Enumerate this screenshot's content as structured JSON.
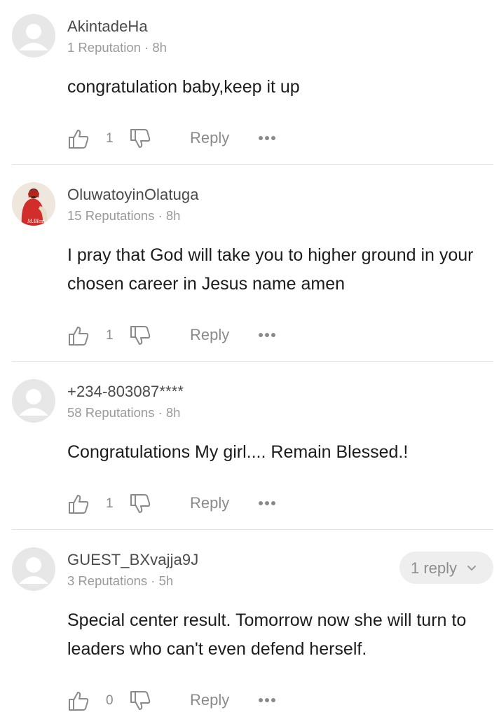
{
  "icons": {
    "like": "thumbs-up-icon",
    "dislike": "thumbs-down-icon",
    "more": "more-horizontal-icon",
    "chevron": "chevron-down-icon"
  },
  "colors": {
    "username": "#4a4a4a",
    "meta": "#9a9a9a",
    "action": "#8a8a8a",
    "divider": "#e4e4e4",
    "pill_bg": "#eeeeee"
  },
  "comments": [
    {
      "username": "AkintadeHa",
      "meta": "1 Reputation · 8h",
      "text": "congratulation baby,keep it up",
      "likes": "1",
      "reply_label": "Reply",
      "avatar": "default-avatar"
    },
    {
      "username": "OluwatoyinOlatuga",
      "meta": "15 Reputations · 8h",
      "text": "I pray that God will take you to higher ground in your chosen career in Jesus name amen",
      "likes": "1",
      "reply_label": "Reply",
      "avatar": "photo-avatar",
      "avatar_caption": "M.Bless"
    },
    {
      "username": "+234-803087****",
      "meta": "58 Reputations · 8h",
      "text": "Congratulations My girl.... Remain Blessed.!",
      "likes": "1",
      "reply_label": "Reply",
      "avatar": "default-avatar"
    },
    {
      "username": "GUEST_BXvajja9J",
      "meta": "3 Reputations · 5h",
      "text": "Special center result. Tomorrow now she will turn to leaders who can't even defend herself.",
      "likes": "0",
      "reply_label": "Reply",
      "avatar": "default-avatar",
      "replies_label": "1 reply"
    }
  ]
}
